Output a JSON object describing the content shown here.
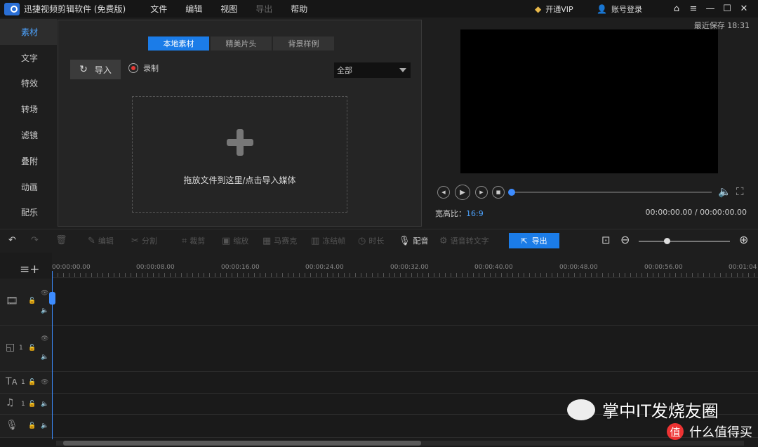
{
  "app": {
    "title": "迅捷视频剪辑软件 (免费版)"
  },
  "menu": [
    "文件",
    "编辑",
    "视图",
    "导出",
    "帮助"
  ],
  "topright": {
    "vip": "开通VIP",
    "login": "账号登录"
  },
  "sidebar": [
    "素材",
    "文字",
    "特效",
    "转场",
    "滤镜",
    "叠附",
    "动画",
    "配乐"
  ],
  "panel": {
    "tabs": [
      "本地素材",
      "精美片头",
      "背景样例"
    ],
    "import": "导入",
    "record": "录制",
    "filter": "全部",
    "drop_text": "拖放文件到这里/点击导入媒体"
  },
  "preview": {
    "saved": "最近保存 18:31",
    "ratio_label": "宽高比：",
    "ratio_value": "16:9",
    "timecode": "00:00:00.00 / 00:00:00.00",
    "progress": 0
  },
  "toolbar": {
    "edit": "编辑",
    "split": "分割",
    "crop": "裁剪",
    "zoom": "缩放",
    "mosaic": "马赛克",
    "freeze": "冻结帧",
    "duration": "时长",
    "dub": "配音",
    "speech": "语音转文字",
    "export": "导出"
  },
  "timeline": {
    "ticks": [
      "00:00:00.00",
      "00:00:08.00",
      "00:00:16.00",
      "00:00:24.00",
      "00:00:32.00",
      "00:00:40.00",
      "00:00:48.00",
      "00:00:56.00",
      "00:01:04"
    ],
    "track_num": "1"
  },
  "watermark": {
    "main": "掌中IT发烧友圈",
    "sub": "什么值得买",
    "sub_icon": "值"
  }
}
